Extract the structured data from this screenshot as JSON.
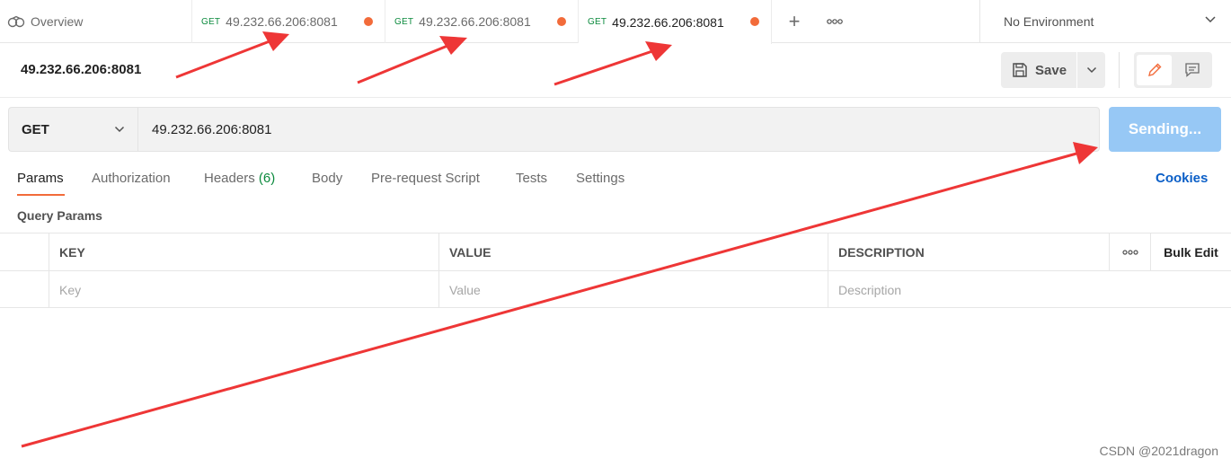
{
  "tabs": {
    "overview_label": "Overview",
    "requests": [
      {
        "method": "GET",
        "url": "49.232.66.206:8081"
      },
      {
        "method": "GET",
        "url": "49.232.66.206:8081"
      },
      {
        "method": "GET",
        "url": "49.232.66.206:8081"
      }
    ],
    "environment": "No Environment"
  },
  "request": {
    "name": "49.232.66.206:8081",
    "method": "GET",
    "url": "49.232.66.206:8081",
    "send_label": "Sending...",
    "save_label": "Save"
  },
  "subtabs": {
    "params": "Params",
    "authorization": "Authorization",
    "headers": "Headers",
    "headers_count": "(6)",
    "body": "Body",
    "prerequest": "Pre-request Script",
    "tests": "Tests",
    "settings": "Settings",
    "cookies": "Cookies"
  },
  "params": {
    "section_title": "Query Params",
    "col_key": "KEY",
    "col_value": "VALUE",
    "col_description": "DESCRIPTION",
    "bulk_edit": "Bulk Edit",
    "placeholder_key": "Key",
    "placeholder_value": "Value",
    "placeholder_description": "Description"
  },
  "watermark": "CSDN @2021dragon",
  "colors": {
    "accent": "#f26b3a",
    "method_green": "#0b8a3d",
    "send_button": "#97c8f5",
    "link_blue": "#0b5fc7",
    "annotation_arrow": "#ee3636"
  }
}
